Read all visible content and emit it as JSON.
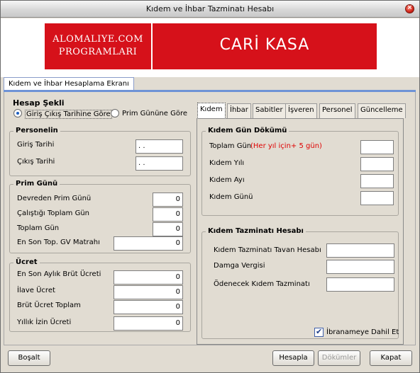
{
  "window": {
    "title": "Kıdem ve İhbar Tazminatı Hesabı"
  },
  "banner": {
    "left_line1": "ALOMALIYE.COM",
    "left_line2": "PROGRAMLARI",
    "right_brand": "CARİ KASA"
  },
  "main_tab": {
    "label": "Kıdem ve İhbar Hesaplama Ekranı"
  },
  "hesap_sekli": {
    "title": "Hesap Şekli",
    "option1": "Giriş Çıkış Tarihine Göre",
    "option2": "Prim Gününe Göre",
    "selected": "option1"
  },
  "personelin": {
    "title": "Personelin",
    "giris_label": "Giriş Tarihi",
    "giris_value": " .  .",
    "cikis_label": "Çıkış Tarihi",
    "cikis_value": " .  ."
  },
  "prim_gunu": {
    "title": "Prim Günü",
    "devreden_label": "Devreden Prim Günü",
    "devreden_value": "0",
    "calistigi_label": "Çalıştığı Toplam Gün",
    "calistigi_value": "0",
    "toplam_label": "Toplam Gün",
    "toplam_value": "0",
    "matrah_label": "En Son Top. GV Matrahı",
    "matrah_value": "0"
  },
  "ucret": {
    "title": "Ücret",
    "brut_label": "En Son Aylık Brüt Ücreti",
    "brut_value": "0",
    "ilave_label": "İlave Ücret",
    "ilave_value": "0",
    "brut_toplam_label": "Brüt Ücret Toplam",
    "brut_toplam_value": "0",
    "izin_label": "Yıllık İzin Ücreti",
    "izin_value": "0"
  },
  "subtabs": [
    "Kıdem",
    "İhbar",
    "Sabitler",
    "İşveren",
    "Personel",
    "Güncelleme"
  ],
  "kidem_gun_dokumu": {
    "title": "Kıdem Gün Dökümü",
    "toplam_gun_label": "Toplam Gün",
    "toplam_gun_note": "(Her yıl için+ 5 gün)",
    "yil_label": "Kıdem Yılı",
    "ay_label": "Kıdem Ayı",
    "gun_label": "Kıdem Günü"
  },
  "kidem_tazminati": {
    "title": "Kıdem Tazminatı Hesabı",
    "tavan_label": "Kıdem Tazminatı Tavan Hesabı",
    "damga_label": "Damga Vergisi",
    "odenecek_label": "Ödenecek Kıdem Tazminatı",
    "ibraname_label": "İbranameye Dahil Et",
    "ibraname_checked": true
  },
  "buttons": {
    "bosalt": "Boşalt",
    "hesapla": "Hesapla",
    "dokumler": "Dökümler",
    "kapat": "Kapat"
  }
}
